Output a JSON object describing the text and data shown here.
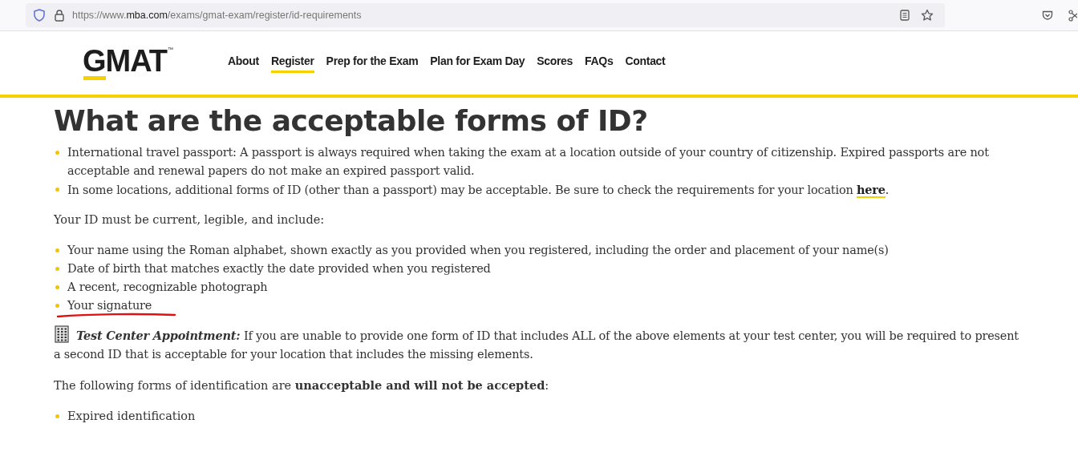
{
  "browser": {
    "url_prefix": "https://www.",
    "url_domain": "mba.com",
    "url_path": "/exams/gmat-exam/register/id-requirements"
  },
  "header": {
    "logo": {
      "text": "GMAT",
      "mark": "™"
    },
    "nav": [
      {
        "label": "About",
        "selected": false
      },
      {
        "label": "Register",
        "selected": true
      },
      {
        "label": "Prep for the Exam",
        "selected": false
      },
      {
        "label": "Plan for Exam Day",
        "selected": false
      },
      {
        "label": "Scores",
        "selected": false
      },
      {
        "label": "FAQs",
        "selected": false
      },
      {
        "label": "Contact",
        "selected": false
      }
    ]
  },
  "heading": "What are the acceptable forms of ID?",
  "id_list": [
    {
      "text": "International travel passport: A passport is always required when taking the exam at a location outside of your country of citizenship. Expired passports are not acceptable and renewal papers do not make an expired passport valid."
    },
    {
      "text": "In some locations, additional forms of ID (other than a passport) may be acceptable. Be sure to check the requirements for your location ",
      "link": "here",
      "after": "."
    }
  ],
  "requirements_intro": "Your ID must be current, legible, and include:",
  "requirements": [
    {
      "text": "Your name using the Roman alphabet, shown exactly as you provided when you registered, including the order and placement of your name(s)",
      "annotated": false
    },
    {
      "text": "Date of birth that matches exactly the date provided when you registered",
      "annotated": false
    },
    {
      "text": "A recent, recognizable photograph",
      "annotated": false
    },
    {
      "text": "Your signature",
      "annotated": true
    }
  ],
  "note": {
    "label": "Test Center Appointment:",
    "text": " If you are unable to provide one form of ID that includes ALL of the above elements at your test center, you will be required to present a second ID that is acceptable for your location that includes the missing elements."
  },
  "unacceptable_intro": "The following forms of identification are **unacceptable and will not be accepted**:",
  "unacceptable": [
    "Expired identification"
  ]
}
